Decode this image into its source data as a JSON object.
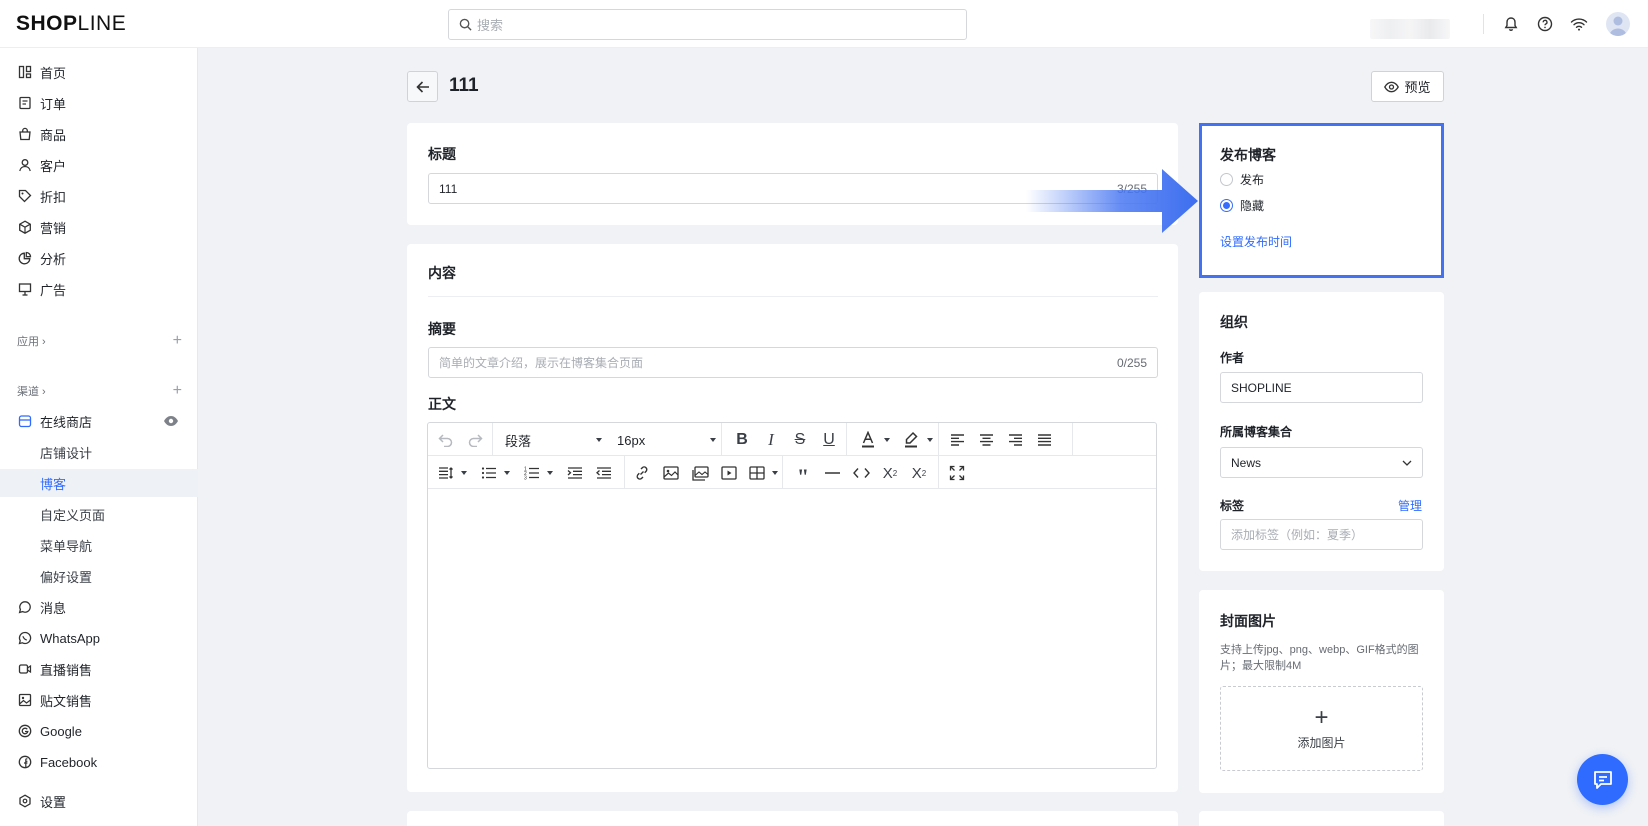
{
  "header": {
    "logo_bold": "SHOP",
    "logo_thin": "LINE",
    "search_placeholder": "搜索"
  },
  "sidebar": {
    "items": [
      {
        "label": "首页",
        "icon": "home-icon"
      },
      {
        "label": "订单",
        "icon": "orders-icon"
      },
      {
        "label": "商品",
        "icon": "products-icon"
      },
      {
        "label": "客户",
        "icon": "customers-icon"
      },
      {
        "label": "折扣",
        "icon": "discount-icon"
      },
      {
        "label": "营销",
        "icon": "marketing-icon"
      },
      {
        "label": "分析",
        "icon": "analytics-icon"
      },
      {
        "label": "广告",
        "icon": "ads-icon"
      }
    ],
    "apps_label": "应用",
    "channels_label": "渠道",
    "online_store": "在线商店",
    "sub_items": [
      "店铺设计",
      "博客",
      "自定义页面",
      "菜单导航",
      "偏好设置"
    ],
    "channel_items": [
      {
        "label": "消息",
        "icon": "message-icon"
      },
      {
        "label": "WhatsApp",
        "icon": "whatsapp-icon"
      },
      {
        "label": "直播销售",
        "icon": "live-icon"
      },
      {
        "label": "贴文销售",
        "icon": "post-icon"
      },
      {
        "label": "Google",
        "icon": "google-icon"
      },
      {
        "label": "Facebook",
        "icon": "facebook-icon"
      }
    ],
    "settings": "设置"
  },
  "page": {
    "title": "111",
    "preview": "预览"
  },
  "title_card": {
    "label": "标题",
    "value": "111",
    "counter": "3/255"
  },
  "content_card": {
    "label": "内容",
    "summary_label": "摘要",
    "summary_placeholder": "简单的文章介绍，展示在博客集合页面",
    "summary_counter": "0/255",
    "body_label": "正文",
    "paragraph_select": "段落",
    "font_size_select": "16px"
  },
  "publish_card": {
    "title": "发布博客",
    "options": [
      "发布",
      "隐藏"
    ],
    "selected": "隐藏",
    "schedule_link": "设置发布时间"
  },
  "org_card": {
    "title": "组织",
    "author_label": "作者",
    "author_value": "SHOPLINE",
    "collection_label": "所属博客集合",
    "collection_value": "News",
    "tags_label": "标签",
    "tags_manage": "管理",
    "tags_placeholder": "添加标签（例如：夏季）"
  },
  "cover_card": {
    "title": "封面图片",
    "hint": "支持上传jpg、png、webp、GIF格式的图片；最大限制4M",
    "upload": "添加图片"
  },
  "colors": {
    "accent": "#2f6bff",
    "highlight_border": "#4471f0",
    "page_bg": "#f0f2f5"
  }
}
